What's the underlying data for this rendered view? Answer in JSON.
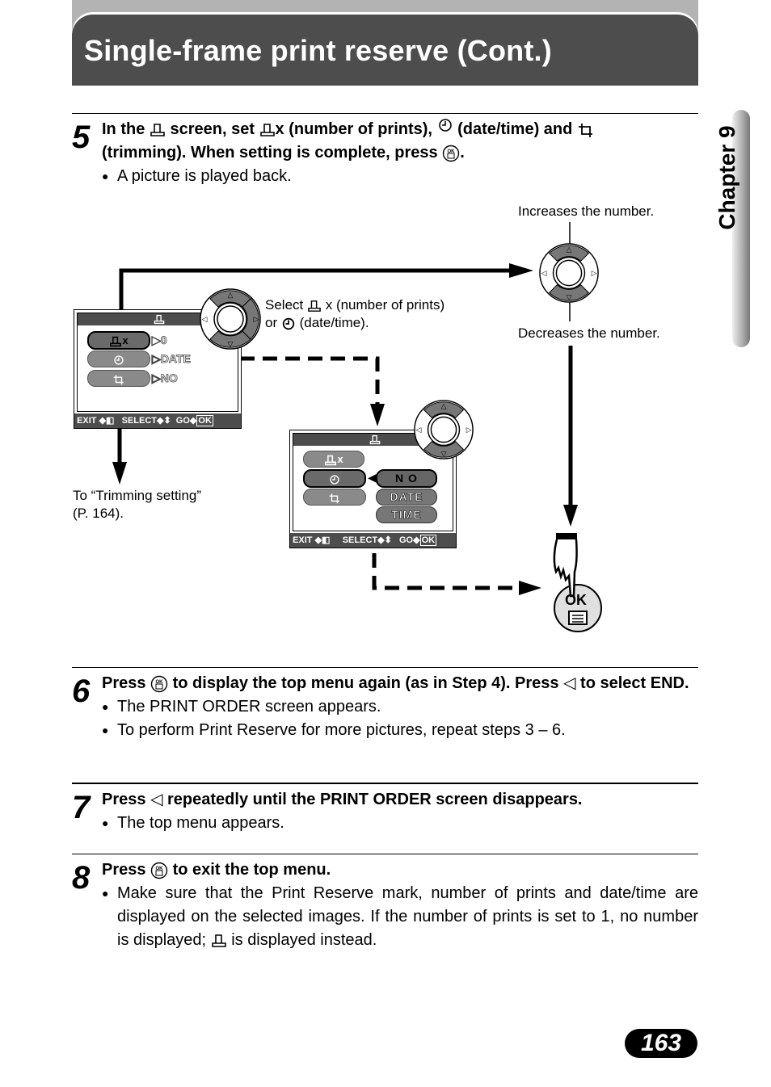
{
  "header": {
    "title": "Single-frame print reserve (Cont.)"
  },
  "chapter_tab": "Chapter 9",
  "page_number": "163",
  "steps": [
    {
      "number": "5",
      "instruction_parts": [
        "In the",
        "screen, set",
        "x (number of prints),",
        "(date/time) and",
        "(trimming). When setting is complete, press",
        "."
      ],
      "bullets": [
        "A picture is played back."
      ]
    },
    {
      "number": "6",
      "instruction_parts": [
        "Press",
        "to display the top menu again (as in Step 4). Press",
        "to select END."
      ],
      "bullets": [
        "The PRINT ORDER screen appears.",
        "To perform Print Reserve for more pictures, repeat steps 3 – 6."
      ]
    },
    {
      "number": "7",
      "instruction_parts": [
        "Press",
        "repeatedly until the PRINT ORDER screen disappears."
      ],
      "bullets": [
        "The top menu appears."
      ]
    },
    {
      "number": "8",
      "instruction_parts": [
        "Press",
        "to exit the top menu."
      ],
      "bullets_parts": [
        "Make sure that the Print Reserve mark, number of prints and date/time are displayed on the selected images. If the number of prints is set to 1, no number is displayed;",
        "is displayed instead."
      ]
    }
  ],
  "diagram": {
    "increase_label": "Increases the number.",
    "decrease_label": "Decreases the number.",
    "select_label_1a": "Select",
    "select_label_1b": "x (number of prints)",
    "select_label_2a": "or",
    "select_label_2b": "(date/time).",
    "trimming_label_1": "To “Trimming setting”",
    "trimming_label_2": "(P. 164).",
    "ok_label": "OK",
    "screen1": {
      "rows": [
        {
          "icon": "print-icon",
          "suffix": "x",
          "value": "0",
          "selected": true
        },
        {
          "icon": "clock-icon",
          "value": "DATE",
          "selected": false
        },
        {
          "icon": "trim-icon",
          "value": "NO",
          "selected": false
        }
      ],
      "footer": {
        "exit": "EXIT",
        "select": "SELECT",
        "go": "GO",
        "ok": "OK"
      }
    },
    "screen2": {
      "rows": [
        {
          "icon": "print-icon",
          "suffix": "x"
        },
        {
          "icon": "clock-icon"
        },
        {
          "icon": "trim-icon"
        }
      ],
      "options": [
        "N O",
        "DATE",
        "TIME"
      ],
      "selected_option": "N O",
      "footer": {
        "exit": "EXIT",
        "select": "SELECT",
        "go": "GO",
        "ok": "OK"
      }
    }
  }
}
